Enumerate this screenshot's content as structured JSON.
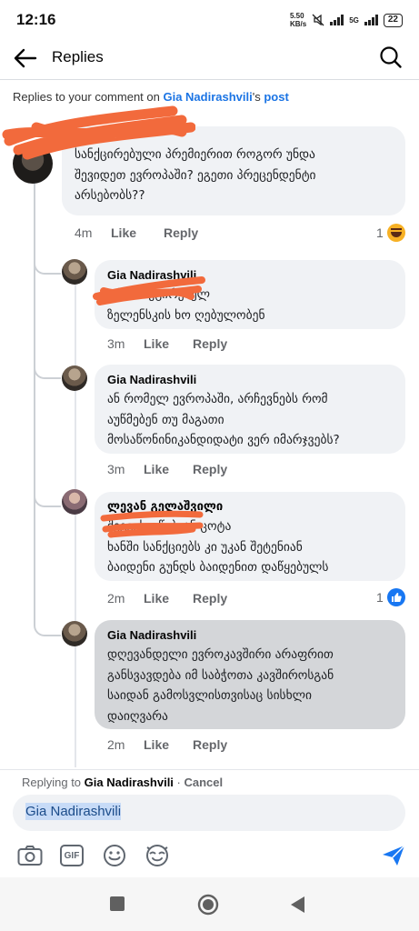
{
  "status": {
    "time": "12:16",
    "speed_value": "5.50",
    "speed_unit": "KB/s",
    "network": "5G",
    "battery": "22"
  },
  "header": {
    "title": "Replies"
  },
  "context": {
    "prefix": "Replies to your comment on ",
    "name": "Gia Nadirashvili",
    "suffix": "'s ",
    "post": "post"
  },
  "comments": [
    {
      "author": "",
      "text": "სანქცირებული პრემიერით როგორ უნდა\nშევიდეთ ევროპაში? ეგეთი პრეცენდენტი\nარსებობს??",
      "time": "4m",
      "like": "Like",
      "reply": "Reply",
      "reactions": "1",
      "reaction_icon": "haha-icon"
    },
    {
      "author": "Gia Nadirashvili",
      "text": "                         არასანქცირებულ\nზელენსკის ხო ღებულობენ",
      "time": "3m",
      "like": "Like",
      "reply": "Reply"
    },
    {
      "author": "Gia Nadirashvili",
      "text": "ან რომელ ევროპაში, არჩევნებს რომ\nაუწმებენ თუ მაგათი\nმოსაწონინიკანდიდატი ვერ იმარჯვებს?",
      "time": "3m",
      "like": "Like",
      "reply": "Reply"
    },
    {
      "author": "ლევან გელაშვილი",
      "text": "                შეგვეხვეწებიან ცოტა\nხანში სანქციებს კი უკან შეტენიან\nბაიდენი გუნდს ბაიდენით დაწყებულს",
      "time": "2m",
      "like": "Like",
      "reply": "Reply",
      "reactions": "1",
      "reaction_icon": "like-icon"
    },
    {
      "author": "Gia Nadirashvili",
      "text": "დღევანდელი ევროკავშირი  არაფრით\nგანსვავდება იმ საბჭოთა კავშიროსგან\nსაიდან გამოსვლისთვისაც სისხლი\nდაიღვარა",
      "time": "2m",
      "like": "Like",
      "reply": "Reply"
    }
  ],
  "composer": {
    "replying_prefix": "Replying to ",
    "replying_name": "Gia Nadirashvili",
    "separator": " · ",
    "cancel": "Cancel",
    "input_value": "Gia Nadirashvili"
  },
  "colors": {
    "accent": "#1877f2",
    "link": "#1b74e4",
    "bubble": "#f0f2f5",
    "bubble_selected": "#d4d6d9",
    "scribble": "#f26a3c"
  }
}
